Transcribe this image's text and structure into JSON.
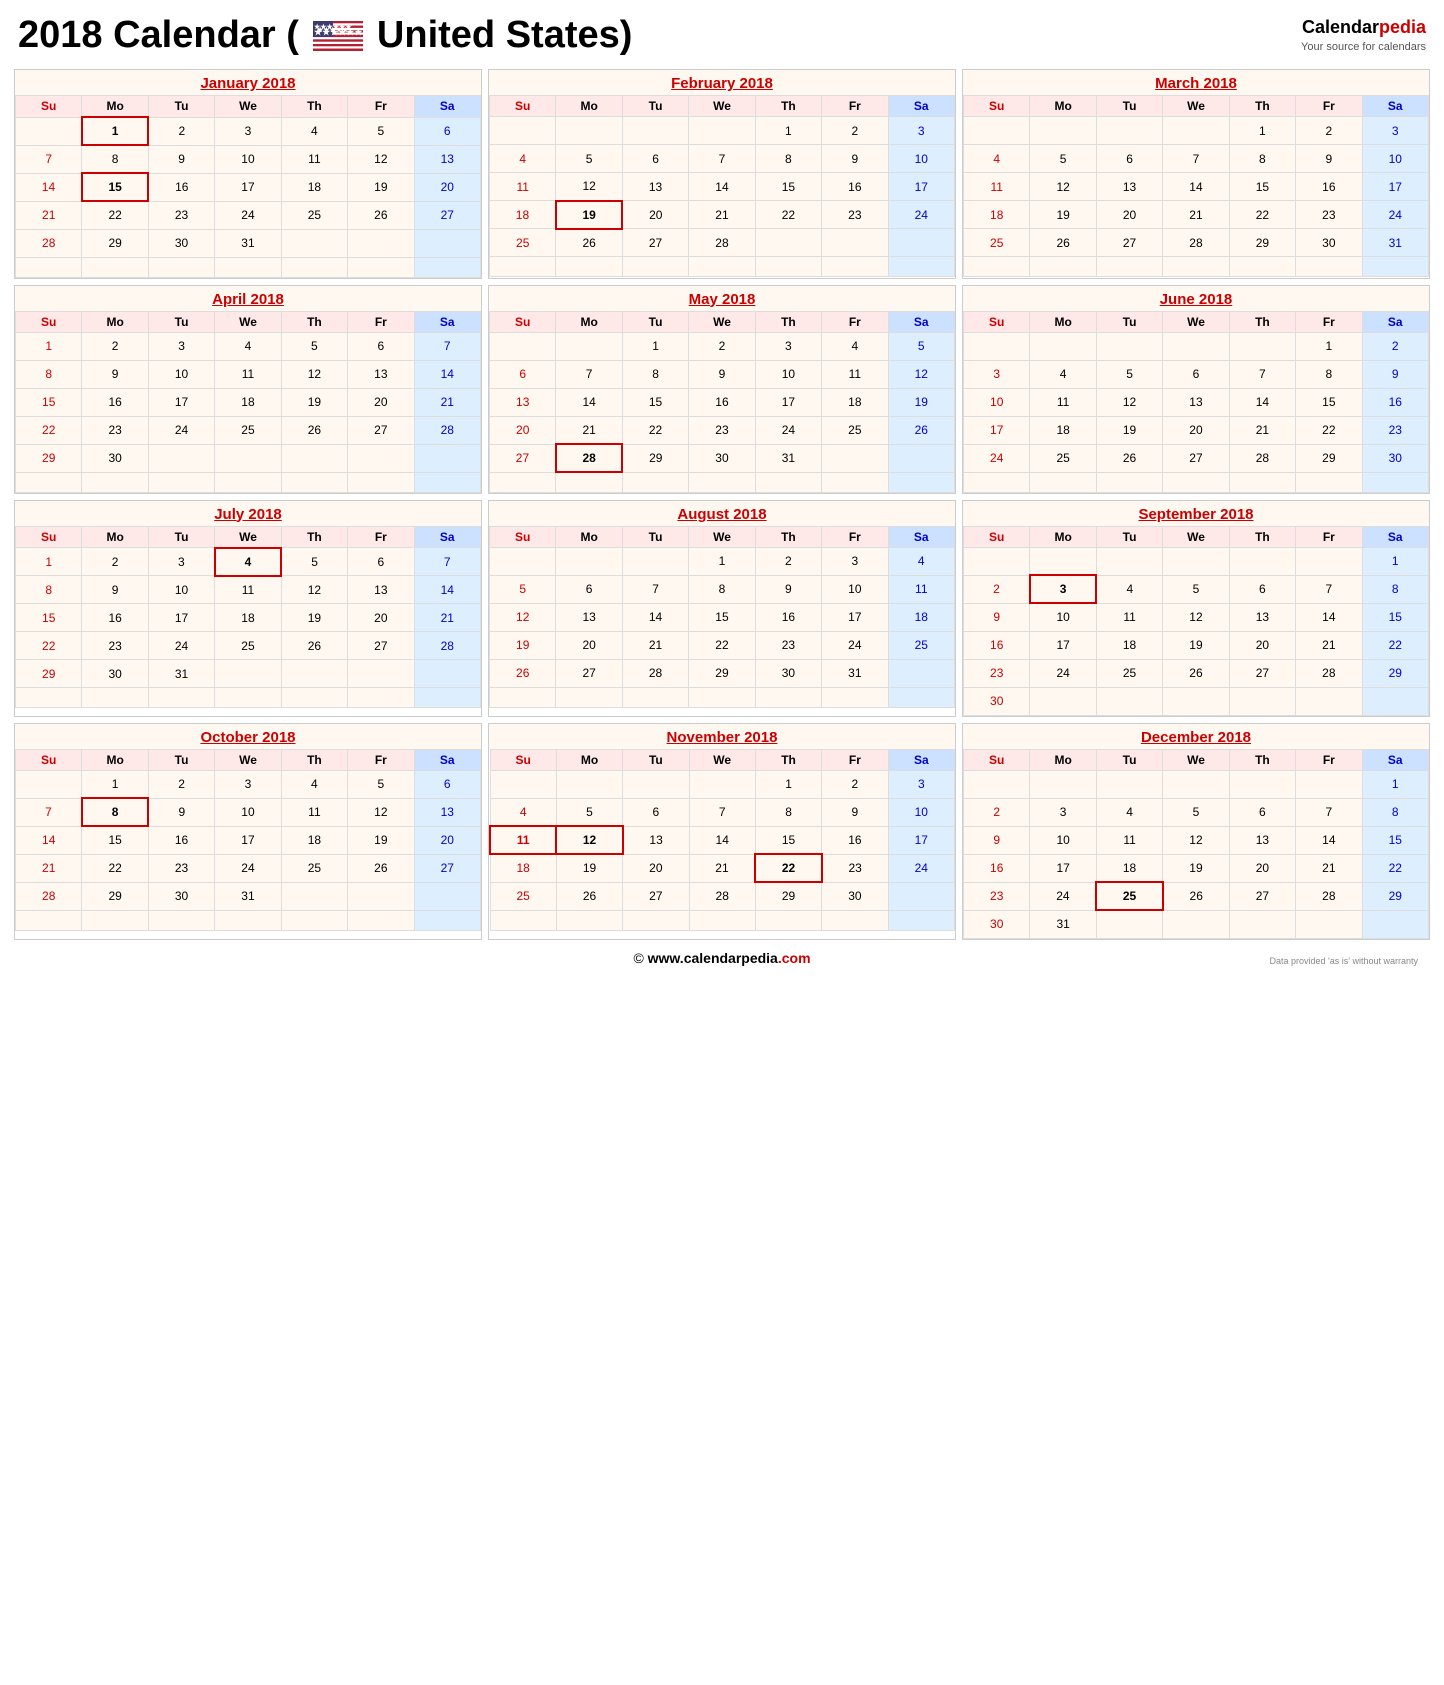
{
  "header": {
    "title": "2018 Calendar (",
    "country": "United States)",
    "logo_brand": "Calendar",
    "logo_brand_accent": "pedia",
    "logo_tagline": "Your source for calendars",
    "logo_url": "Calendarpedia"
  },
  "footer": {
    "copyright": "©",
    "url_main": "www.calendarpedia",
    "url_ext": ".com",
    "disclaimer": "Data provided 'as is' without warranty"
  },
  "months": [
    {
      "name": "January 2018",
      "weeks": [
        [
          "",
          "Mo",
          "Tu",
          "We",
          "Th",
          "Fr",
          "Sa"
        ],
        [
          null,
          1,
          2,
          3,
          4,
          5,
          6
        ],
        [
          7,
          8,
          9,
          10,
          11,
          12,
          13
        ],
        [
          14,
          15,
          16,
          17,
          18,
          19,
          20
        ],
        [
          21,
          22,
          23,
          24,
          25,
          26,
          27
        ],
        [
          28,
          29,
          30,
          31,
          null,
          null,
          null
        ],
        [
          null,
          null,
          null,
          null,
          null,
          null,
          null
        ]
      ],
      "holidays": [
        1,
        15
      ]
    },
    {
      "name": "February 2018",
      "weeks": [
        [
          "",
          "Mo",
          "Tu",
          "We",
          "Th",
          "Fr",
          "Sa"
        ],
        [
          null,
          null,
          null,
          null,
          1,
          2,
          3
        ],
        [
          4,
          5,
          6,
          7,
          8,
          9,
          10
        ],
        [
          11,
          12,
          13,
          14,
          15,
          16,
          17
        ],
        [
          18,
          19,
          20,
          21,
          22,
          23,
          24
        ],
        [
          25,
          26,
          27,
          28,
          null,
          null,
          null
        ],
        [
          null,
          null,
          null,
          null,
          null,
          null,
          null
        ]
      ],
      "holidays": [
        19
      ]
    },
    {
      "name": "March 2018",
      "weeks": [
        [
          "",
          "Mo",
          "Tu",
          "We",
          "Th",
          "Fr",
          "Sa"
        ],
        [
          null,
          null,
          null,
          null,
          1,
          2,
          3
        ],
        [
          4,
          5,
          6,
          7,
          8,
          9,
          10
        ],
        [
          11,
          12,
          13,
          14,
          15,
          16,
          17
        ],
        [
          18,
          19,
          20,
          21,
          22,
          23,
          24
        ],
        [
          25,
          26,
          27,
          28,
          29,
          30,
          31
        ],
        [
          null,
          null,
          null,
          null,
          null,
          null,
          null
        ]
      ],
      "holidays": []
    },
    {
      "name": "April 2018",
      "weeks": [
        [
          "",
          "Mo",
          "Tu",
          "We",
          "Th",
          "Fr",
          "Sa"
        ],
        [
          1,
          2,
          3,
          4,
          5,
          6,
          7
        ],
        [
          8,
          9,
          10,
          11,
          12,
          13,
          14
        ],
        [
          15,
          16,
          17,
          18,
          19,
          20,
          21
        ],
        [
          22,
          23,
          24,
          25,
          26,
          27,
          28
        ],
        [
          29,
          30,
          null,
          null,
          null,
          null,
          null
        ],
        [
          null,
          null,
          null,
          null,
          null,
          null,
          null
        ]
      ],
      "holidays": []
    },
    {
      "name": "May 2018",
      "weeks": [
        [
          "",
          "Mo",
          "Tu",
          "We",
          "Th",
          "Fr",
          "Sa"
        ],
        [
          null,
          null,
          1,
          2,
          3,
          4,
          5
        ],
        [
          6,
          7,
          8,
          9,
          10,
          11,
          12
        ],
        [
          13,
          14,
          15,
          16,
          17,
          18,
          19
        ],
        [
          20,
          21,
          22,
          23,
          24,
          25,
          26
        ],
        [
          27,
          28,
          29,
          30,
          31,
          null,
          null
        ],
        [
          null,
          null,
          null,
          null,
          null,
          null,
          null
        ]
      ],
      "holidays": [
        28
      ]
    },
    {
      "name": "June 2018",
      "weeks": [
        [
          "",
          "Mo",
          "Tu",
          "We",
          "Th",
          "Fr",
          "Sa"
        ],
        [
          null,
          null,
          null,
          null,
          null,
          1,
          2
        ],
        [
          3,
          4,
          5,
          6,
          7,
          8,
          9
        ],
        [
          10,
          11,
          12,
          13,
          14,
          15,
          16
        ],
        [
          17,
          18,
          19,
          20,
          21,
          22,
          23
        ],
        [
          24,
          25,
          26,
          27,
          28,
          29,
          30
        ],
        [
          null,
          null,
          null,
          null,
          null,
          null,
          null
        ]
      ],
      "holidays": []
    },
    {
      "name": "July 2018",
      "weeks": [
        [
          "",
          "Mo",
          "Tu",
          "We",
          "Th",
          "Fr",
          "Sa"
        ],
        [
          1,
          2,
          3,
          4,
          5,
          6,
          7
        ],
        [
          8,
          9,
          10,
          11,
          12,
          13,
          14
        ],
        [
          15,
          16,
          17,
          18,
          19,
          20,
          21
        ],
        [
          22,
          23,
          24,
          25,
          26,
          27,
          28
        ],
        [
          29,
          30,
          31,
          null,
          null,
          null,
          null
        ],
        [
          null,
          null,
          null,
          null,
          null,
          null,
          null
        ]
      ],
      "holidays": [
        4
      ]
    },
    {
      "name": "August 2018",
      "weeks": [
        [
          "",
          "Mo",
          "Tu",
          "We",
          "Th",
          "Fr",
          "Sa"
        ],
        [
          null,
          null,
          null,
          1,
          2,
          3,
          4
        ],
        [
          5,
          6,
          7,
          8,
          9,
          10,
          11
        ],
        [
          12,
          13,
          14,
          15,
          16,
          17,
          18
        ],
        [
          19,
          20,
          21,
          22,
          23,
          24,
          25
        ],
        [
          26,
          27,
          28,
          29,
          30,
          31,
          null
        ],
        [
          null,
          null,
          null,
          null,
          null,
          null,
          null
        ]
      ],
      "holidays": []
    },
    {
      "name": "September 2018",
      "weeks": [
        [
          "",
          "Mo",
          "Tu",
          "We",
          "Th",
          "Fr",
          "Sa"
        ],
        [
          null,
          null,
          null,
          null,
          null,
          null,
          1
        ],
        [
          2,
          3,
          4,
          5,
          6,
          7,
          8
        ],
        [
          9,
          10,
          11,
          12,
          13,
          14,
          15
        ],
        [
          16,
          17,
          18,
          19,
          20,
          21,
          22
        ],
        [
          23,
          24,
          25,
          26,
          27,
          28,
          29
        ],
        [
          30,
          null,
          null,
          null,
          null,
          null,
          null
        ]
      ],
      "holidays": [
        3
      ]
    },
    {
      "name": "October 2018",
      "weeks": [
        [
          "",
          "Mo",
          "Tu",
          "We",
          "Th",
          "Fr",
          "Sa"
        ],
        [
          null,
          1,
          2,
          3,
          4,
          5,
          6
        ],
        [
          7,
          8,
          9,
          10,
          11,
          12,
          13
        ],
        [
          14,
          15,
          16,
          17,
          18,
          19,
          20
        ],
        [
          21,
          22,
          23,
          24,
          25,
          26,
          27
        ],
        [
          28,
          29,
          30,
          31,
          null,
          null,
          null
        ],
        [
          null,
          null,
          null,
          null,
          null,
          null,
          null
        ]
      ],
      "holidays": [
        8
      ]
    },
    {
      "name": "November 2018",
      "weeks": [
        [
          "",
          "Mo",
          "Tu",
          "We",
          "Th",
          "Fr",
          "Sa"
        ],
        [
          null,
          null,
          null,
          null,
          1,
          2,
          3
        ],
        [
          4,
          5,
          6,
          7,
          8,
          9,
          10
        ],
        [
          11,
          12,
          13,
          14,
          15,
          16,
          17
        ],
        [
          18,
          19,
          20,
          21,
          22,
          23,
          24
        ],
        [
          25,
          26,
          27,
          28,
          29,
          30,
          null
        ],
        [
          null,
          null,
          null,
          null,
          null,
          null,
          null
        ]
      ],
      "holidays": [
        11,
        12,
        22
      ]
    },
    {
      "name": "December 2018",
      "weeks": [
        [
          "",
          "Mo",
          "Tu",
          "We",
          "Th",
          "Fr",
          "Sa"
        ],
        [
          null,
          null,
          null,
          null,
          null,
          null,
          1
        ],
        [
          2,
          3,
          4,
          5,
          6,
          7,
          8
        ],
        [
          9,
          10,
          11,
          12,
          13,
          14,
          15
        ],
        [
          16,
          17,
          18,
          19,
          20,
          21,
          22
        ],
        [
          23,
          24,
          25,
          26,
          27,
          28,
          29
        ],
        [
          30,
          31,
          null,
          null,
          null,
          null,
          null
        ]
      ],
      "holidays": [
        25
      ]
    }
  ]
}
